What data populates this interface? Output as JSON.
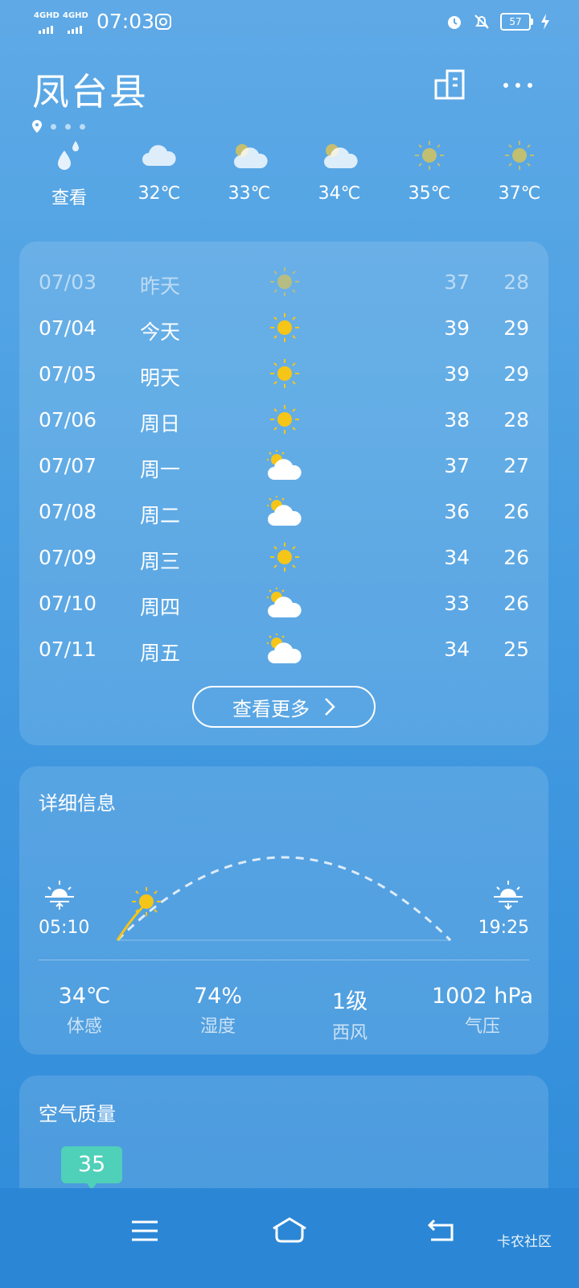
{
  "status_bar": {
    "signal1": "4GHD",
    "signal2": "4GHD",
    "time": "07:03",
    "battery": "57"
  },
  "header": {
    "city": "凤台县"
  },
  "hourly": [
    {
      "label": "查看",
      "icon": "rain-drops-icon"
    },
    {
      "label": "32℃",
      "icon": "cloud-icon"
    },
    {
      "label": "33℃",
      "icon": "partly-cloudy-icon"
    },
    {
      "label": "34℃",
      "icon": "partly-cloudy-icon"
    },
    {
      "label": "35℃",
      "icon": "sun-icon"
    },
    {
      "label": "37℃",
      "icon": "sun-icon"
    }
  ],
  "forecast": {
    "rows": [
      {
        "date": "07/03",
        "day": "昨天",
        "icon": "sun-icon",
        "high": "37",
        "low": "28"
      },
      {
        "date": "07/04",
        "day": "今天",
        "icon": "sun-icon",
        "high": "39",
        "low": "29"
      },
      {
        "date": "07/05",
        "day": "明天",
        "icon": "sun-icon",
        "high": "39",
        "low": "29"
      },
      {
        "date": "07/06",
        "day": "周日",
        "icon": "sun-icon",
        "high": "38",
        "low": "28"
      },
      {
        "date": "07/07",
        "day": "周一",
        "icon": "partly-cloudy-icon",
        "high": "37",
        "low": "27"
      },
      {
        "date": "07/08",
        "day": "周二",
        "icon": "partly-cloudy-icon",
        "high": "36",
        "low": "26"
      },
      {
        "date": "07/09",
        "day": "周三",
        "icon": "sun-icon",
        "high": "34",
        "low": "26"
      },
      {
        "date": "07/10",
        "day": "周四",
        "icon": "partly-cloudy-icon",
        "high": "33",
        "low": "26"
      },
      {
        "date": "07/11",
        "day": "周五",
        "icon": "partly-cloudy-icon",
        "high": "34",
        "low": "25"
      }
    ],
    "more_label": "查看更多"
  },
  "detail": {
    "title": "详细信息",
    "sunrise": "05:10",
    "sunset": "19:25",
    "metrics": [
      {
        "value": "34℃",
        "label": "体感"
      },
      {
        "value": "74%",
        "label": "湿度"
      },
      {
        "value": "1级",
        "label": "西风"
      },
      {
        "value": "1002 hPa",
        "label": "气压"
      }
    ]
  },
  "air": {
    "title": "空气质量",
    "aqi": "35"
  },
  "footer": {
    "watermark": "卡农社区"
  },
  "colors": {
    "sun": "#f5c518",
    "aqi_good": "#4fd0b8",
    "bg_top": "#5fa9e6",
    "bg_bottom": "#2f8bd9"
  }
}
